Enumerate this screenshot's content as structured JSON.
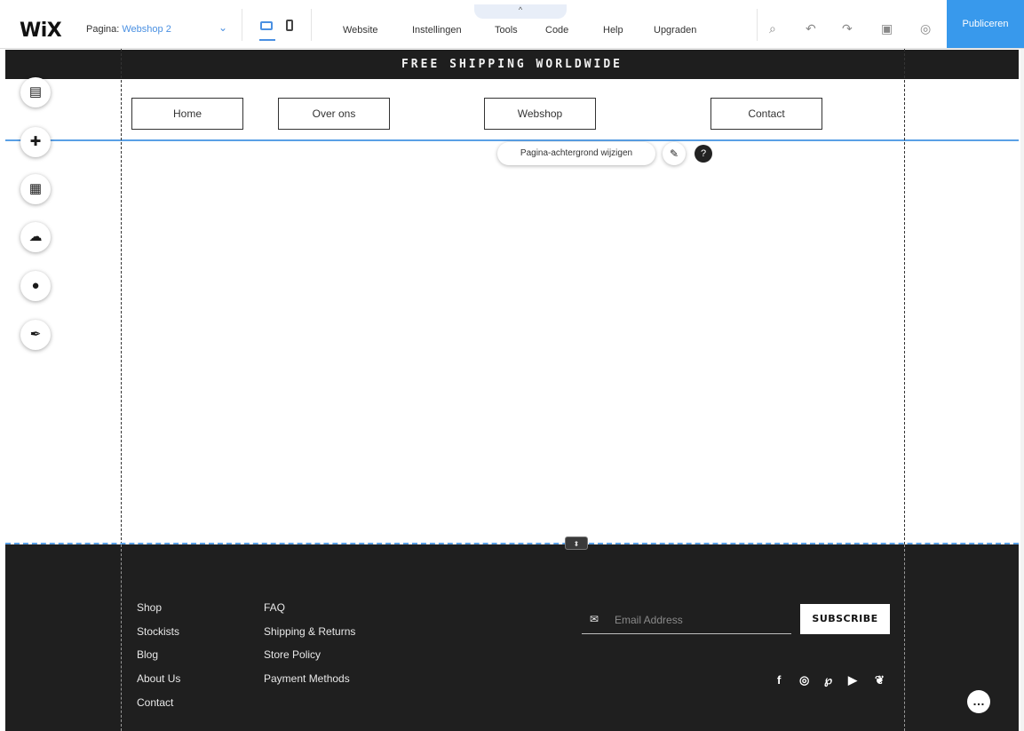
{
  "topbar": {
    "logo": "WiX",
    "page_label": "Pagina:",
    "page_value": "Webshop 2",
    "page_chevron": "⌄",
    "tools_tab_glyph": "^",
    "menu": [
      "Website",
      "Instellingen",
      "Tools",
      "Code",
      "Help",
      "Upgraden"
    ],
    "icons": {
      "zoom": "⌕",
      "undo": "↶",
      "redo": "↷",
      "save": "▣",
      "preview": "◎"
    },
    "publish_label": "Publiceren",
    "accent_color": "#3899ec"
  },
  "banner": {
    "text": "FREE SHIPPING WORLDWIDE"
  },
  "nav": [
    "Home",
    "Over ons",
    "Webshop",
    "Contact"
  ],
  "background_pill": {
    "label": "Pagina-achtergrond wijzigen"
  },
  "header_tools": {
    "edit_icon": "✎",
    "help_icon": "?"
  },
  "sidebar": [
    {
      "name": "menus-pages",
      "glyph": "▤"
    },
    {
      "name": "add",
      "glyph": "✚"
    },
    {
      "name": "add-apps",
      "glyph": "▦"
    },
    {
      "name": "media-upload",
      "glyph": "☁"
    },
    {
      "name": "chat",
      "glyph": "●"
    },
    {
      "name": "blog",
      "glyph": "✒"
    }
  ],
  "footer": {
    "handle_glyph": "⬍",
    "col1": [
      "Shop",
      "Stockists",
      "Blog",
      "About Us",
      "Contact"
    ],
    "col2": [
      "FAQ",
      "Shipping & Returns",
      "Store Policy",
      "Payment Methods"
    ],
    "email_icon": "✉",
    "email_placeholder": "Email Address",
    "subscribe_label": "SUBSCRIBE",
    "social_icons": [
      "facebook-icon",
      "instagram-icon",
      "pinterest-icon",
      "youtube-icon",
      "twitter-icon"
    ],
    "social_glyphs": [
      "f",
      "◎",
      "℘",
      "▶",
      "❦"
    ],
    "chat_glyph": "…"
  }
}
